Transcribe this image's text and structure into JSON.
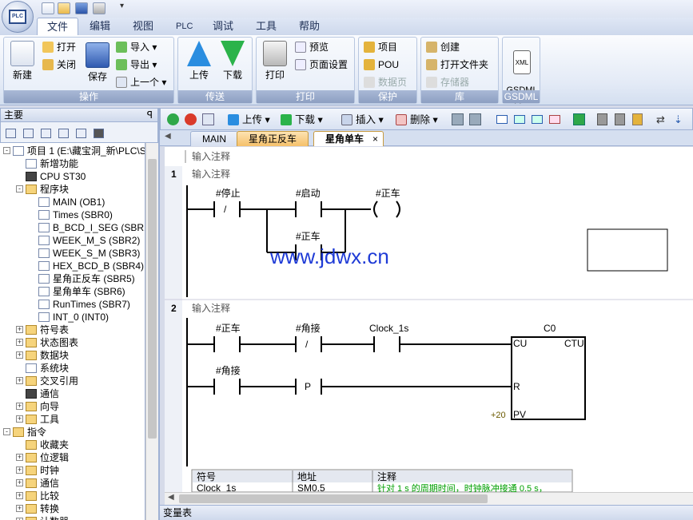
{
  "ribbon_tabs": [
    "文件",
    "编辑",
    "视图",
    "PLC",
    "调试",
    "工具",
    "帮助"
  ],
  "groups": {
    "operate": {
      "label": "操作",
      "new": "新建",
      "open": "打开",
      "close": "关闭",
      "save": "保存",
      "import": "导入",
      "export": "导出",
      "prev": "上一个"
    },
    "transfer": {
      "label": "传送",
      "upload": "上传",
      "download": "下载"
    },
    "print": {
      "label": "打印",
      "print": "打印",
      "preview": "预览",
      "page_setup": "页面设置"
    },
    "protect": {
      "label": "保护",
      "project": "项目",
      "pou": "POU",
      "datablock": "数据页"
    },
    "library": {
      "label": "库",
      "create": "创建",
      "open_folder": "打开文件夹",
      "memory": "存储器"
    },
    "gsdml": {
      "label": "GSDML",
      "manage": "GSDML\n管理",
      "icon_text": "XML"
    }
  },
  "left_panel": {
    "title": "主要",
    "pin": "ꟼ"
  },
  "tree": [
    {
      "label": "项目 1 (E:\\藏宝洞_新\\PLC\\S",
      "level": 0,
      "pm": "-",
      "icon": "prog"
    },
    {
      "label": "新增功能",
      "level": 1,
      "pm": "",
      "icon": "help"
    },
    {
      "label": "CPU ST30",
      "level": 1,
      "pm": "",
      "icon": "cpu"
    },
    {
      "label": "程序块",
      "level": 1,
      "pm": "-",
      "icon": "folder"
    },
    {
      "label": "MAIN (OB1)",
      "level": 2,
      "pm": "",
      "icon": "prog"
    },
    {
      "label": "Times (SBR0)",
      "level": 2,
      "pm": "",
      "icon": "prog"
    },
    {
      "label": "B_BCD_I_SEG (SBR1",
      "level": 2,
      "pm": "",
      "icon": "prog"
    },
    {
      "label": "WEEK_M_S (SBR2)",
      "level": 2,
      "pm": "",
      "icon": "prog"
    },
    {
      "label": "WEEK_S_M (SBR3)",
      "level": 2,
      "pm": "",
      "icon": "prog"
    },
    {
      "label": "HEX_BCD_B (SBR4)",
      "level": 2,
      "pm": "",
      "icon": "prog"
    },
    {
      "label": "星角正反车 (SBR5)",
      "level": 2,
      "pm": "",
      "icon": "prog"
    },
    {
      "label": "星角单车 (SBR6)",
      "level": 2,
      "pm": "",
      "icon": "prog"
    },
    {
      "label": "RunTimes (SBR7)",
      "level": 2,
      "pm": "",
      "icon": "prog"
    },
    {
      "label": "INT_0 (INT0)",
      "level": 2,
      "pm": "",
      "icon": "prog"
    },
    {
      "label": "符号表",
      "level": 1,
      "pm": "+",
      "icon": "folder"
    },
    {
      "label": "状态图表",
      "level": 1,
      "pm": "+",
      "icon": "folder"
    },
    {
      "label": "数据块",
      "level": 1,
      "pm": "+",
      "icon": "folder"
    },
    {
      "label": "系统块",
      "level": 1,
      "pm": "",
      "icon": "prog"
    },
    {
      "label": "交叉引用",
      "level": 1,
      "pm": "+",
      "icon": "folder"
    },
    {
      "label": "通信",
      "level": 1,
      "pm": "",
      "icon": "sys"
    },
    {
      "label": "向导",
      "level": 1,
      "pm": "+",
      "icon": "folder"
    },
    {
      "label": "工具",
      "level": 1,
      "pm": "+",
      "icon": "folder"
    },
    {
      "label": "指令",
      "level": 0,
      "pm": "-",
      "icon": "folder"
    },
    {
      "label": "收藏夹",
      "level": 1,
      "pm": "",
      "icon": "folder"
    },
    {
      "label": "位逻辑",
      "level": 1,
      "pm": "+",
      "icon": "folder"
    },
    {
      "label": "时钟",
      "level": 1,
      "pm": "+",
      "icon": "folder"
    },
    {
      "label": "通信",
      "level": 1,
      "pm": "+",
      "icon": "folder"
    },
    {
      "label": "比较",
      "level": 1,
      "pm": "+",
      "icon": "folder"
    },
    {
      "label": "转换",
      "level": 1,
      "pm": "+",
      "icon": "folder"
    },
    {
      "label": "计数器",
      "level": 1,
      "pm": "+",
      "icon": "folder"
    }
  ],
  "editor_toolbar": {
    "upload": "上传",
    "download": "下载",
    "insert": "插入",
    "delete": "删除"
  },
  "doc_tabs": [
    "MAIN",
    "星角正反车",
    "星角单车"
  ],
  "editor": {
    "comment_top": "输入注释",
    "networks": [
      {
        "num": "1",
        "comment": "输入注释",
        "contacts": [
          "#停止",
          "#启动",
          "#正车"
        ],
        "coil": "#正车",
        "contact_marks": [
          "/",
          ""
        ]
      },
      {
        "num": "2",
        "comment": "输入注释",
        "contacts": [
          "#正车",
          "#角接",
          "Clock_1s",
          "#角接"
        ],
        "contact_marks": [
          "",
          "/",
          "",
          "P"
        ],
        "counter": {
          "name": "C0",
          "type": "CTU",
          "cu": "CU",
          "r": "R",
          "pv": "PV",
          "pv_value": "+20"
        }
      }
    ],
    "watermark": "www.jdwx.cn",
    "symbol_table": {
      "headers": [
        "符号",
        "地址",
        "注释"
      ],
      "rows": [
        [
          "Clock_1s",
          "SM0.5",
          "针对 1 s 的周期时间，时钟脉冲接通 0.5 s，"
        ]
      ]
    }
  },
  "bottom_panel": {
    "title": "变量表"
  },
  "colors": {
    "accent": "#1e2f55",
    "watermark": "#1f3bd6",
    "comment_green": "#00a000"
  }
}
